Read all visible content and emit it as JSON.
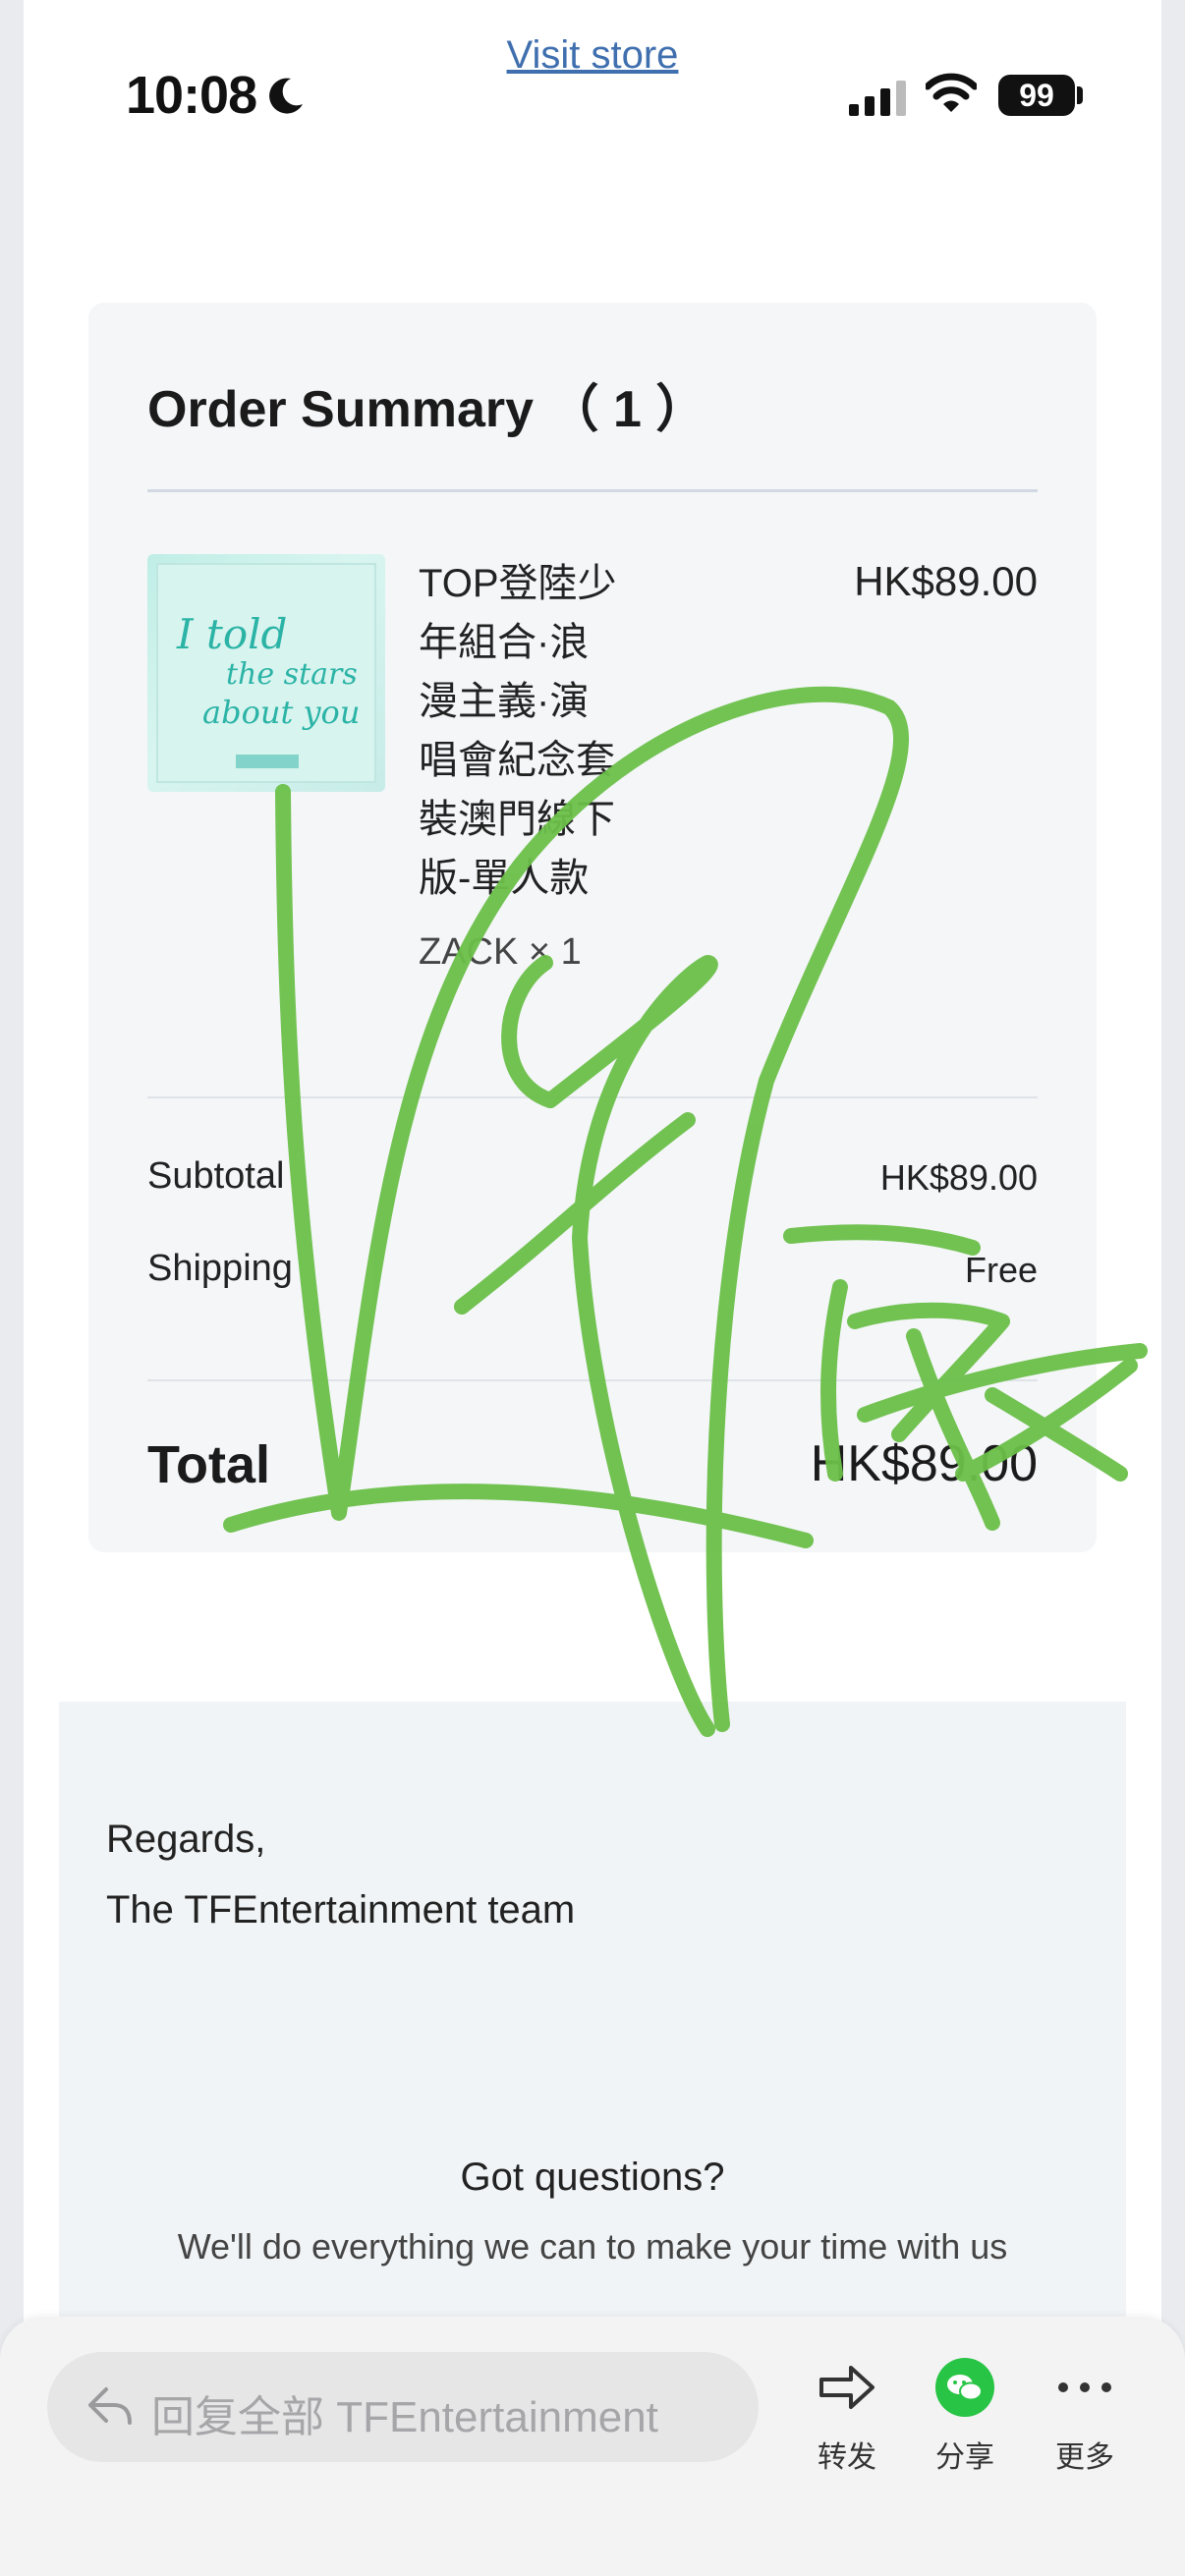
{
  "status_bar": {
    "time": "10:08",
    "battery": "99"
  },
  "header": {
    "visit_store": "Visit store"
  },
  "order": {
    "title": "Order Summary （ 1 ）",
    "product": {
      "name_lines": [
        "TOP登陸少",
        "年組合·浪",
        "漫主義·演",
        "唱會紀念套",
        "裝澳門線下",
        "版-單人款"
      ],
      "variant": "ZACK × 1",
      "price": "HK$89.00",
      "image_text": [
        "I told",
        "the stars",
        "about you"
      ]
    },
    "subtotal_label": "Subtotal",
    "subtotal_value": "HK$89.00",
    "shipping_label": "Shipping",
    "shipping_value": "Free",
    "total_label": "Total",
    "total_value": "HK$89.00"
  },
  "footer": {
    "regards_line1": "Regards,",
    "regards_line2": "The TFEntertainment team",
    "questions_title": "Got questions?",
    "questions_text": "We'll do everything we can to make your time with us"
  },
  "reply_bar": {
    "placeholder": "回复全部  TFEntertainment",
    "forward_label": "转发",
    "share_label": "分享",
    "more_label": "更多"
  },
  "colors": {
    "link": "#3f6fae",
    "signature": "#6cc04a",
    "wechat": "#28c445",
    "card_bg": "#f4f6f8"
  },
  "icons": [
    "moon-icon",
    "signal-icon",
    "wifi-icon",
    "battery-icon",
    "reply-all-icon",
    "forward-icon",
    "wechat-icon",
    "more-icon"
  ]
}
